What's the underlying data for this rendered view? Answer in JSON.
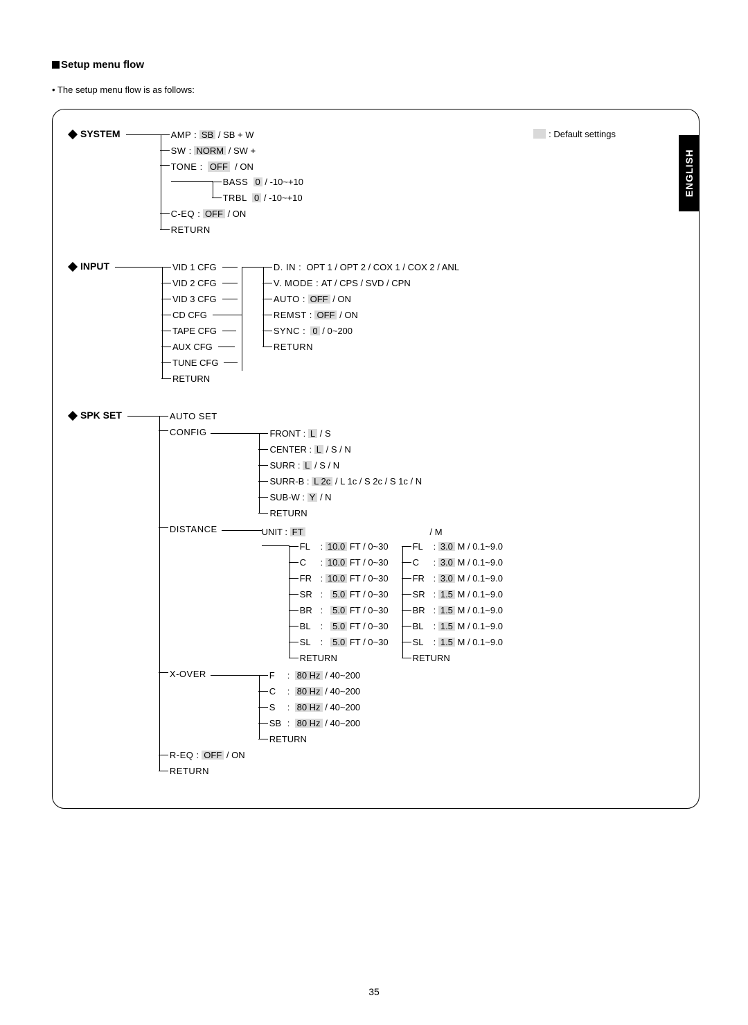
{
  "page_number": "35",
  "language_tab": "ENGLISH",
  "heading": "Setup menu flow",
  "intro_bullet": "• The setup menu flow is as follows:",
  "legend": ": Default settings",
  "system": {
    "title": "SYSTEM",
    "amp": {
      "label": "AMP :",
      "default": "SB",
      "rest": "/ SB + W"
    },
    "sw": {
      "label": "SW   :",
      "default": "NORM",
      "rest": "/ SW +"
    },
    "tone": {
      "label": "TONE :",
      "default": "OFF",
      "rest": "/ ON"
    },
    "bass": {
      "label": "BASS",
      "default": "0",
      "rest": "/ -10~+10"
    },
    "trbl": {
      "label": "TRBL",
      "default": "0",
      "rest": "/ -10~+10"
    },
    "ceq": {
      "label": "C-EQ :",
      "default": "OFF",
      "rest": "/ ON"
    },
    "return": "RETURN"
  },
  "input": {
    "title": "INPUT",
    "sources": [
      "VID 1  CFG",
      "VID 2  CFG",
      "VID 3  CFG",
      "CD CFG",
      "TAPE  CFG",
      "AUX   CFG",
      "TUNE CFG",
      "RETURN"
    ],
    "din": {
      "label": "D. IN    :",
      "rest": "OPT 1 / OPT 2 / COX 1 / COX 2 / ANL"
    },
    "vmode": {
      "label": "V. MODE :",
      "rest": "AT / CPS / SVD / CPN"
    },
    "auto": {
      "label": "AUTO   :",
      "default": "OFF",
      "rest": "/ ON"
    },
    "remst": {
      "label": "REMST :",
      "default": "OFF",
      "rest": "/ ON"
    },
    "sync": {
      "label": "SYNC   :",
      "default": "0",
      "rest": "/ 0~200"
    },
    "return": "RETURN"
  },
  "spk": {
    "title": "SPK SET",
    "auto": "AUTO SET",
    "config_label": "CONFIG",
    "config": {
      "front": {
        "label": "FRONT  :",
        "default": "L",
        "rest": "/ S"
      },
      "center": {
        "label": "CENTER :",
        "default": "L",
        "rest": "/ S / N"
      },
      "surr": {
        "label": "SURR    :",
        "default": "L",
        "rest": "/ S / N"
      },
      "surrb": {
        "label": "SURR-B :",
        "default": "L 2c",
        "rest": "/ L 1c / S 2c / S 1c / N"
      },
      "subw": {
        "label": "SUB-W  :",
        "default": "Y",
        "rest": "/ N"
      },
      "return": "RETURN"
    },
    "distance_label": "DISTANCE",
    "distance": {
      "unit": {
        "label": "UNIT :",
        "default": "FT",
        "alt": "/   M"
      },
      "ft": {
        "FL": {
          "d": "10.0",
          "r": "FT / 0~30"
        },
        "C": {
          "d": "10.0",
          "r": "FT / 0~30"
        },
        "FR": {
          "d": "10.0",
          "r": "FT / 0~30"
        },
        "SR": {
          "d": "5.0",
          "r": "FT / 0~30"
        },
        "BR": {
          "d": "5.0",
          "r": "FT / 0~30"
        },
        "BL": {
          "d": "5.0",
          "r": "FT / 0~30"
        },
        "SL": {
          "d": "5.0",
          "r": "FT / 0~30"
        },
        "return": "RETURN"
      },
      "m": {
        "FL": {
          "d": "3.0",
          "r": "M / 0.1~9.0"
        },
        "C": {
          "d": "3.0",
          "r": "M / 0.1~9.0"
        },
        "FR": {
          "d": "3.0",
          "r": "M / 0.1~9.0"
        },
        "SR": {
          "d": "1.5",
          "r": "M / 0.1~9.0"
        },
        "BR": {
          "d": "1.5",
          "r": "M / 0.1~9.0"
        },
        "BL": {
          "d": "1.5",
          "r": "M / 0.1~9.0"
        },
        "SL": {
          "d": "1.5",
          "r": "M / 0.1~9.0"
        },
        "return": "RETURN"
      }
    },
    "xover_label": "X-OVER",
    "xover": {
      "F": {
        "d": "80 Hz",
        "r": "/ 40~200"
      },
      "C": {
        "d": "80 Hz",
        "r": "/ 40~200"
      },
      "S": {
        "d": "80 Hz",
        "r": "/ 40~200"
      },
      "SB": {
        "d": "80 Hz",
        "r": "/ 40~200"
      },
      "return": "RETURN"
    },
    "req": {
      "label": "R-EQ :",
      "default": "OFF",
      "rest": "/ ON"
    },
    "return": "RETURN"
  }
}
